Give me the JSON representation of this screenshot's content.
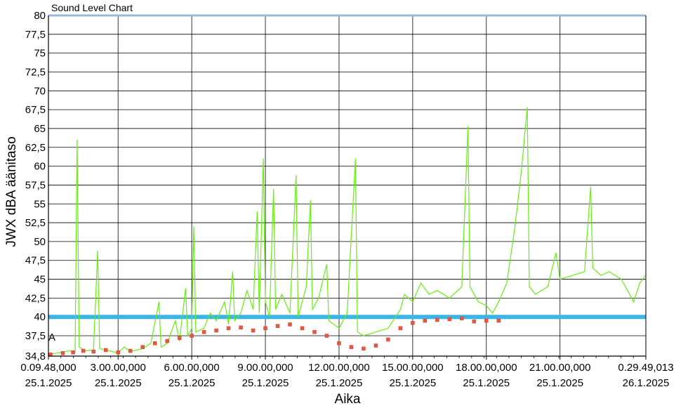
{
  "chart_data": {
    "type": "line",
    "title": "Sound Level Chart",
    "xlabel": "Aika",
    "ylabel": "JWX dBA äänitaso",
    "ylim": [
      34.8,
      80
    ],
    "yticks": [
      "34,8",
      "37,5",
      "40",
      "42,5",
      "45",
      "47,5",
      "50",
      "52,5",
      "55",
      "57,5",
      "60",
      "62,5",
      "65",
      "67,5",
      "70",
      "72,5",
      "75",
      "77,5",
      "80"
    ],
    "xlim": [
      "2025-01-25T00:09:48",
      "2025-01-26T00:29:49"
    ],
    "xticks": [
      {
        "time": "2025-01-25T00:09:48",
        "line1": "0.09.48,000",
        "line2": "25.1.2025"
      },
      {
        "time": "2025-01-25T03:00:00",
        "line1": "3.00.00,000",
        "line2": "25.1.2025"
      },
      {
        "time": "2025-01-25T06:00:00",
        "line1": "6.00.00,000",
        "line2": "25.1.2025"
      },
      {
        "time": "2025-01-25T09:00:00",
        "line1": "9.00.00,000",
        "line2": "25.1.2025"
      },
      {
        "time": "2025-01-25T12:00:00",
        "line1": "12.00.00,000",
        "line2": "25.1.2025"
      },
      {
        "time": "2025-01-25T15:00:00",
        "line1": "15.00.00,000",
        "line2": "25.1.2025"
      },
      {
        "time": "2025-01-25T18:00:00",
        "line1": "18.00.00,000",
        "line2": "25.1.2025"
      },
      {
        "time": "2025-01-25T21:00:00",
        "line1": "21.00.00,000",
        "line2": "25.1.2025"
      },
      {
        "time": "2025-01-26T00:29:49",
        "line1": "0.29.49,013",
        "line2": "26.1.2025"
      }
    ],
    "grid": true,
    "reference_lines": [
      {
        "value": 40,
        "color": "#3cb4e6"
      },
      {
        "value": 80,
        "color": "#9bb7d4"
      }
    ],
    "annotation": "A",
    "series": [
      {
        "style": "line",
        "color": "#66ee11",
        "points": [
          [
            "2025-01-25T00:10:00",
            35.0
          ],
          [
            "2025-01-25T00:30:00",
            35.2
          ],
          [
            "2025-01-25T01:00:00",
            35.5
          ],
          [
            "2025-01-25T01:15:00",
            35.4
          ],
          [
            "2025-01-25T01:20:00",
            63.5
          ],
          [
            "2025-01-25T01:25:00",
            36.0
          ],
          [
            "2025-01-25T01:40:00",
            35.5
          ],
          [
            "2025-01-25T02:00:00",
            35.6
          ],
          [
            "2025-01-25T02:10:00",
            48.8
          ],
          [
            "2025-01-25T02:15:00",
            35.8
          ],
          [
            "2025-01-25T02:40:00",
            35.5
          ],
          [
            "2025-01-25T03:00:00",
            35.2
          ],
          [
            "2025-01-25T03:15:00",
            36.0
          ],
          [
            "2025-01-25T03:30:00",
            35.4
          ],
          [
            "2025-01-25T04:00:00",
            35.8
          ],
          [
            "2025-01-25T04:20:00",
            36.5
          ],
          [
            "2025-01-25T04:40:00",
            42.0
          ],
          [
            "2025-01-25T04:45:00",
            36.0
          ],
          [
            "2025-01-25T05:00:00",
            36.5
          ],
          [
            "2025-01-25T05:20:00",
            39.5
          ],
          [
            "2025-01-25T05:30:00",
            36.8
          ],
          [
            "2025-01-25T05:45:00",
            43.8
          ],
          [
            "2025-01-25T05:50:00",
            37.5
          ],
          [
            "2025-01-25T06:00:00",
            38.5
          ],
          [
            "2025-01-25T06:05:00",
            52.0
          ],
          [
            "2025-01-25T06:10:00",
            38.0
          ],
          [
            "2025-01-25T06:30:00",
            38.5
          ],
          [
            "2025-01-25T06:45:00",
            40.5
          ],
          [
            "2025-01-25T07:00:00",
            39.5
          ],
          [
            "2025-01-25T07:20:00",
            42.0
          ],
          [
            "2025-01-25T07:30:00",
            39.0
          ],
          [
            "2025-01-25T07:40:00",
            46.0
          ],
          [
            "2025-01-25T07:45:00",
            39.5
          ],
          [
            "2025-01-25T08:00:00",
            40.5
          ],
          [
            "2025-01-25T08:15:00",
            43.5
          ],
          [
            "2025-01-25T08:30:00",
            41.0
          ],
          [
            "2025-01-25T08:40:00",
            54.0
          ],
          [
            "2025-01-25T08:45:00",
            40.5
          ],
          [
            "2025-01-25T08:55:00",
            61.0
          ],
          [
            "2025-01-25T09:00:00",
            42.0
          ],
          [
            "2025-01-25T09:10:00",
            40.0
          ],
          [
            "2025-01-25T09:20:00",
            57.0
          ],
          [
            "2025-01-25T09:25:00",
            41.0
          ],
          [
            "2025-01-25T09:40:00",
            43.0
          ],
          [
            "2025-01-25T10:00:00",
            40.5
          ],
          [
            "2025-01-25T10:15:00",
            58.8
          ],
          [
            "2025-01-25T10:20:00",
            40.0
          ],
          [
            "2025-01-25T10:40:00",
            44.0
          ],
          [
            "2025-01-25T10:50:00",
            55.5
          ],
          [
            "2025-01-25T10:55:00",
            41.0
          ],
          [
            "2025-01-25T11:10:00",
            42.5
          ],
          [
            "2025-01-25T11:30:00",
            47.0
          ],
          [
            "2025-01-25T11:35:00",
            39.5
          ],
          [
            "2025-01-25T12:00:00",
            38.5
          ],
          [
            "2025-01-25T12:20:00",
            40.5
          ],
          [
            "2025-01-25T12:40:00",
            61.0
          ],
          [
            "2025-01-25T12:45:00",
            38.0
          ],
          [
            "2025-01-25T13:00:00",
            37.5
          ],
          [
            "2025-01-25T13:30:00",
            38.0
          ],
          [
            "2025-01-25T14:00:00",
            38.5
          ],
          [
            "2025-01-25T14:30:00",
            41.0
          ],
          [
            "2025-01-25T14:40:00",
            43.0
          ],
          [
            "2025-01-25T15:00:00",
            42.0
          ],
          [
            "2025-01-25T15:20:00",
            44.5
          ],
          [
            "2025-01-25T15:40:00",
            43.0
          ],
          [
            "2025-01-25T16:00:00",
            43.5
          ],
          [
            "2025-01-25T16:30:00",
            42.5
          ],
          [
            "2025-01-25T17:00:00",
            44.0
          ],
          [
            "2025-01-25T17:15:00",
            65.3
          ],
          [
            "2025-01-25T17:20:00",
            44.0
          ],
          [
            "2025-01-25T17:40:00",
            42.0
          ],
          [
            "2025-01-25T18:00:00",
            41.5
          ],
          [
            "2025-01-25T18:15:00",
            40.5
          ],
          [
            "2025-01-25T18:30:00",
            42.0
          ],
          [
            "2025-01-25T18:50:00",
            44.5
          ],
          [
            "2025-01-25T19:10:00",
            52.0
          ],
          [
            "2025-01-25T19:25:00",
            59.0
          ],
          [
            "2025-01-25T19:40:00",
            67.8
          ],
          [
            "2025-01-25T19:45:00",
            44.0
          ],
          [
            "2025-01-25T20:00:00",
            43.0
          ],
          [
            "2025-01-25T20:30:00",
            44.0
          ],
          [
            "2025-01-25T20:50:00",
            48.5
          ],
          [
            "2025-01-25T21:00:00",
            45.0
          ],
          [
            "2025-01-25T21:30:00",
            45.5
          ],
          [
            "2025-01-25T22:00:00",
            46.0
          ],
          [
            "2025-01-25T22:15:00",
            57.3
          ],
          [
            "2025-01-25T22:20:00",
            46.5
          ],
          [
            "2025-01-25T22:40:00",
            45.5
          ],
          [
            "2025-01-25T23:00:00",
            46.0
          ],
          [
            "2025-01-25T23:30:00",
            45.0
          ],
          [
            "2025-01-26T00:00:00",
            42.0
          ],
          [
            "2025-01-26T00:15:00",
            44.5
          ],
          [
            "2025-01-26T00:29:00",
            45.5
          ]
        ]
      },
      {
        "style": "markers",
        "color": "#e8583a",
        "points": [
          [
            "2025-01-25T00:15:00",
            35.0
          ],
          [
            "2025-01-25T00:45:00",
            35.2
          ],
          [
            "2025-01-25T01:10:00",
            35.3
          ],
          [
            "2025-01-25T01:35:00",
            35.5
          ],
          [
            "2025-01-25T02:00:00",
            35.4
          ],
          [
            "2025-01-25T02:30:00",
            35.6
          ],
          [
            "2025-01-25T03:00:00",
            35.3
          ],
          [
            "2025-01-25T03:30:00",
            35.5
          ],
          [
            "2025-01-25T04:00:00",
            36.0
          ],
          [
            "2025-01-25T04:30:00",
            36.5
          ],
          [
            "2025-01-25T05:00:00",
            36.8
          ],
          [
            "2025-01-25T05:30:00",
            37.2
          ],
          [
            "2025-01-25T06:00:00",
            37.5
          ],
          [
            "2025-01-25T06:30:00",
            38.0
          ],
          [
            "2025-01-25T07:00:00",
            38.2
          ],
          [
            "2025-01-25T07:30:00",
            38.5
          ],
          [
            "2025-01-25T08:00:00",
            38.6
          ],
          [
            "2025-01-25T08:30:00",
            38.2
          ],
          [
            "2025-01-25T09:00:00",
            38.5
          ],
          [
            "2025-01-25T09:30:00",
            38.8
          ],
          [
            "2025-01-25T10:00:00",
            39.0
          ],
          [
            "2025-01-25T10:30:00",
            38.5
          ],
          [
            "2025-01-25T11:00:00",
            38.0
          ],
          [
            "2025-01-25T11:30:00",
            37.5
          ],
          [
            "2025-01-25T12:00:00",
            36.5
          ],
          [
            "2025-01-25T12:30:00",
            36.0
          ],
          [
            "2025-01-25T13:00:00",
            35.8
          ],
          [
            "2025-01-25T13:30:00",
            36.2
          ],
          [
            "2025-01-25T14:00:00",
            37.0
          ],
          [
            "2025-01-25T14:30:00",
            38.5
          ],
          [
            "2025-01-25T15:00:00",
            39.2
          ],
          [
            "2025-01-25T15:30:00",
            39.5
          ],
          [
            "2025-01-25T16:00:00",
            39.6
          ],
          [
            "2025-01-25T16:30:00",
            39.7
          ],
          [
            "2025-01-25T17:00:00",
            39.8
          ],
          [
            "2025-01-25T17:30:00",
            39.4
          ],
          [
            "2025-01-25T18:00:00",
            39.5
          ],
          [
            "2025-01-25T18:30:00",
            39.5
          ]
        ]
      }
    ]
  }
}
